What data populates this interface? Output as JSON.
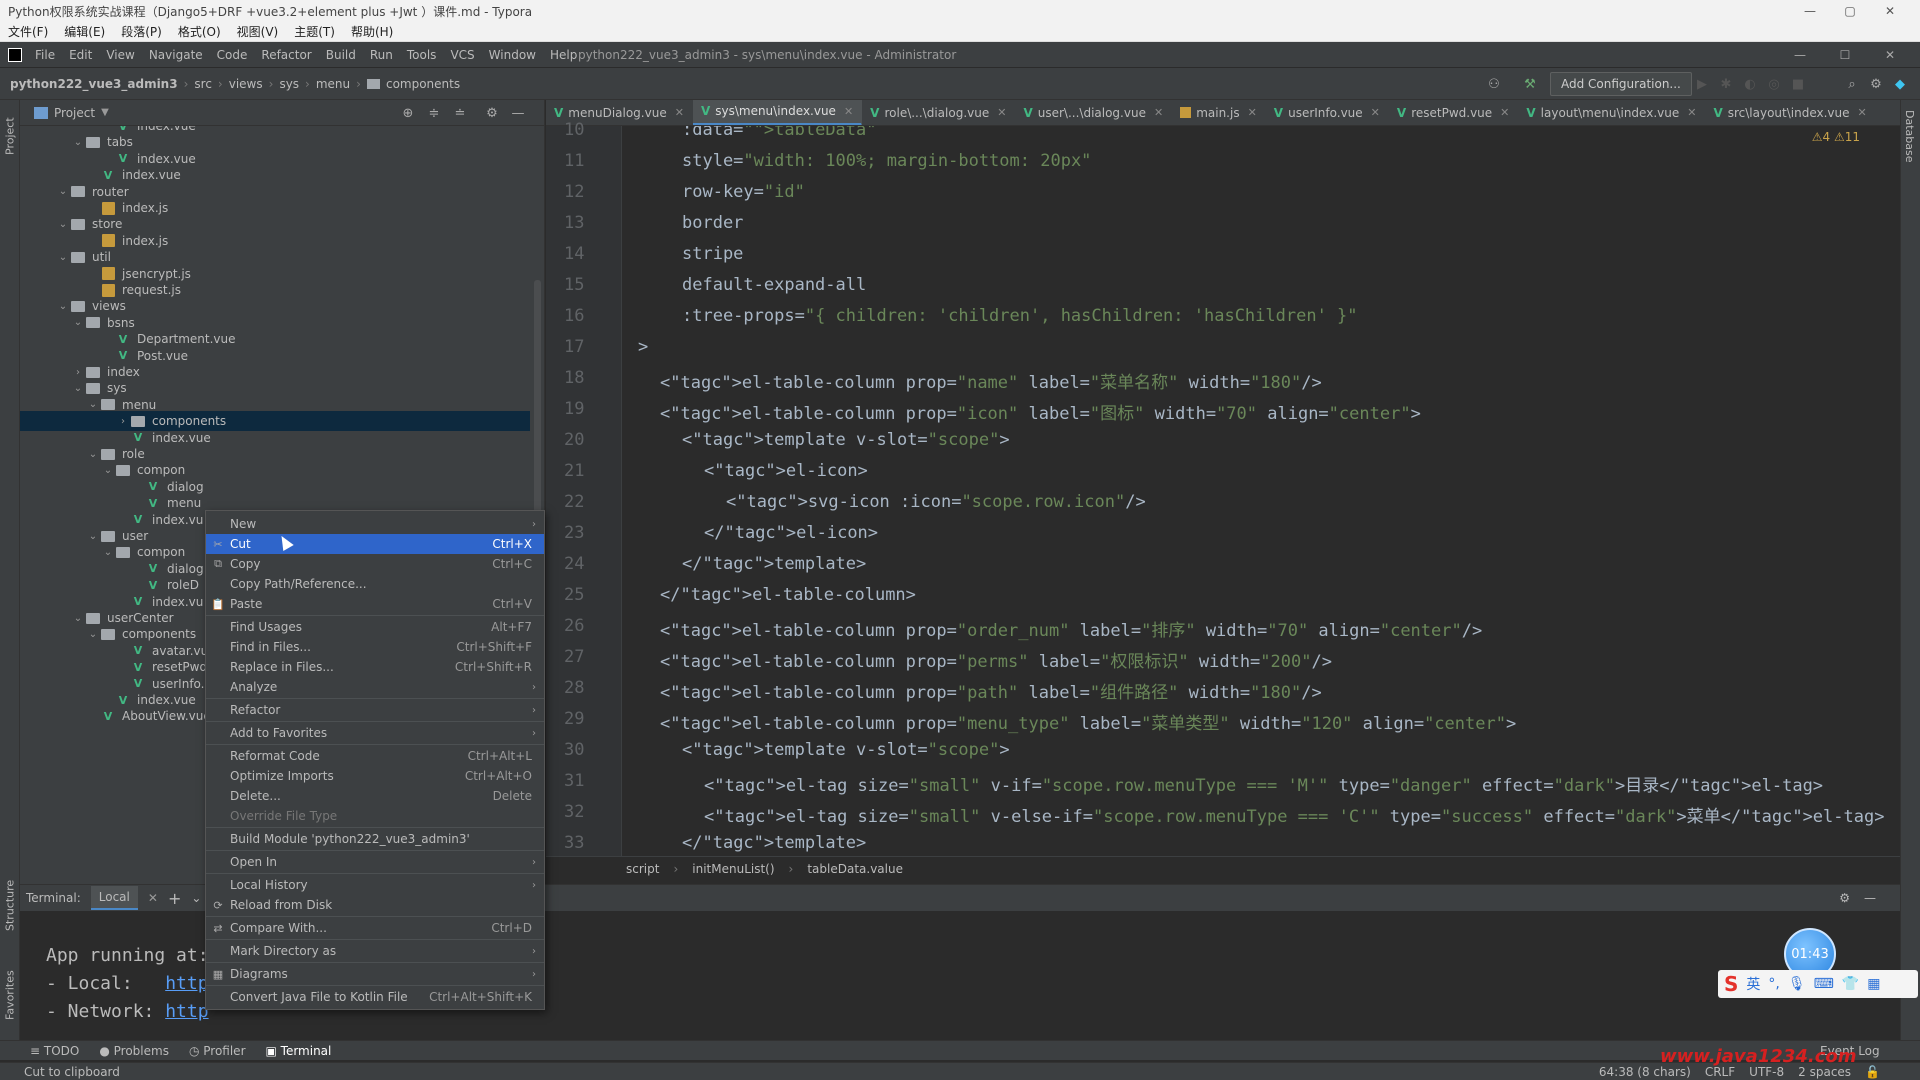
{
  "typora": {
    "title": "Python权限系统实战课程（Django5+DRF +vue3.2+element plus +Jwt ）课件.md - Typora",
    "menu": [
      "文件(F)",
      "编辑(E)",
      "段落(P)",
      "格式(O)",
      "视图(V)",
      "主题(T)",
      "帮助(H)"
    ]
  },
  "ide": {
    "menu": [
      "File",
      "Edit",
      "View",
      "Navigate",
      "Code",
      "Refactor",
      "Build",
      "Run",
      "Tools",
      "VCS",
      "Window",
      "Help"
    ],
    "window_title": "python222_vue3_admin3 - sys\\menu\\index.vue - Administrator",
    "breadcrumb": [
      "python222_vue3_admin3",
      "src",
      "views",
      "sys",
      "menu",
      "components"
    ],
    "add_configuration": "Add Configuration..."
  },
  "project": {
    "label": "Project",
    "strip_label": "Project",
    "tree": [
      {
        "label": "index.vue",
        "type": "vue",
        "depth": 5
      },
      {
        "label": "tabs",
        "type": "folder",
        "depth": 3,
        "open": true
      },
      {
        "label": "index.vue",
        "type": "vue",
        "depth": 5
      },
      {
        "label": "index.vue",
        "type": "vue",
        "depth": 4
      },
      {
        "label": "router",
        "type": "folder",
        "depth": 2,
        "open": true
      },
      {
        "label": "index.js",
        "type": "js",
        "depth": 4
      },
      {
        "label": "store",
        "type": "folder",
        "depth": 2,
        "open": true
      },
      {
        "label": "index.js",
        "type": "js",
        "depth": 4
      },
      {
        "label": "util",
        "type": "folder",
        "depth": 2,
        "open": true
      },
      {
        "label": "jsencrypt.js",
        "type": "js",
        "depth": 4
      },
      {
        "label": "request.js",
        "type": "js",
        "depth": 4
      },
      {
        "label": "views",
        "type": "folder",
        "depth": 2,
        "open": true
      },
      {
        "label": "bsns",
        "type": "folder",
        "depth": 3,
        "open": true
      },
      {
        "label": "Department.vue",
        "type": "vue",
        "depth": 5
      },
      {
        "label": "Post.vue",
        "type": "vue",
        "depth": 5
      },
      {
        "label": "index",
        "type": "folder",
        "depth": 3,
        "open": false
      },
      {
        "label": "sys",
        "type": "folder",
        "depth": 3,
        "open": true
      },
      {
        "label": "menu",
        "type": "folder",
        "depth": 4,
        "open": true
      },
      {
        "label": "components",
        "type": "folder",
        "depth": 6,
        "selected": true
      },
      {
        "label": "index.vue",
        "type": "vue",
        "depth": 6
      },
      {
        "label": "role",
        "type": "folder",
        "depth": 4,
        "open": true
      },
      {
        "label": "compon",
        "type": "folder",
        "depth": 5,
        "open": true
      },
      {
        "label": "dialog",
        "type": "vue",
        "depth": 7
      },
      {
        "label": "menu",
        "type": "vue",
        "depth": 7
      },
      {
        "label": "index.vu",
        "type": "vue",
        "depth": 6
      },
      {
        "label": "user",
        "type": "folder",
        "depth": 4,
        "open": true
      },
      {
        "label": "compon",
        "type": "folder",
        "depth": 5,
        "open": true
      },
      {
        "label": "dialog",
        "type": "vue",
        "depth": 7
      },
      {
        "label": "roleD",
        "type": "vue",
        "depth": 7
      },
      {
        "label": "index.vu",
        "type": "vue",
        "depth": 6
      },
      {
        "label": "userCenter",
        "type": "folder",
        "depth": 3,
        "open": true
      },
      {
        "label": "components",
        "type": "folder",
        "depth": 4,
        "open": true
      },
      {
        "label": "avatar.vu",
        "type": "vue",
        "depth": 6
      },
      {
        "label": "resetPwd",
        "type": "vue",
        "depth": 6
      },
      {
        "label": "userInfo.",
        "type": "vue",
        "depth": 6
      },
      {
        "label": "index.vue",
        "type": "vue",
        "depth": 5
      },
      {
        "label": "AboutView.vue",
        "type": "vue",
        "depth": 4
      }
    ]
  },
  "tabs": [
    {
      "label": "menuDialog.vue",
      "kind": "vue"
    },
    {
      "label": "sys\\menu\\index.vue",
      "kind": "vue",
      "active": true
    },
    {
      "label": "role\\...\\dialog.vue",
      "kind": "vue"
    },
    {
      "label": "user\\...\\dialog.vue",
      "kind": "vue"
    },
    {
      "label": "main.js",
      "kind": "js"
    },
    {
      "label": "userInfo.vue",
      "kind": "vue"
    },
    {
      "label": "resetPwd.vue",
      "kind": "vue"
    },
    {
      "label": "layout\\menu\\index.vue",
      "kind": "vue"
    },
    {
      "label": "src\\layout\\index.vue",
      "kind": "vue"
    }
  ],
  "editor": {
    "warnings": "⚠4 ⚠11",
    "lines": [
      {
        "n": "10",
        "indent": 4,
        "html": ":data=\"<i>tableData</i>\""
      },
      {
        "n": "11",
        "indent": 4,
        "html": "style=\"width: 100%; margin-bottom: 20px\""
      },
      {
        "n": "12",
        "indent": 4,
        "html": "row-key=\"id\""
      },
      {
        "n": "13",
        "indent": 4,
        "html": "border"
      },
      {
        "n": "14",
        "indent": 4,
        "html": "stripe"
      },
      {
        "n": "15",
        "indent": 4,
        "html": "default-expand-all"
      },
      {
        "n": "16",
        "indent": 4,
        "html": ":tree-props=\"{ children: 'children', hasChildren: 'hasChildren' }\""
      },
      {
        "n": "17",
        "indent": 2,
        "html": ">"
      },
      {
        "n": "18",
        "indent": 3,
        "html": "<el-table-column prop=\"name\" label=\"菜单名称\" width=\"180\"/>"
      },
      {
        "n": "19",
        "indent": 3,
        "html": "<el-table-column prop=\"icon\" label=\"图标\" width=\"70\" align=\"center\">"
      },
      {
        "n": "20",
        "indent": 4,
        "html": "<template v-slot=\"scope\">"
      },
      {
        "n": "21",
        "indent": 5,
        "html": "<el-icon>"
      },
      {
        "n": "22",
        "indent": 6,
        "html": "<svg-icon :icon=\"scope.row.icon\"/>"
      },
      {
        "n": "23",
        "indent": 5,
        "html": "</el-icon>"
      },
      {
        "n": "24",
        "indent": 4,
        "html": "</template>"
      },
      {
        "n": "25",
        "indent": 3,
        "html": "</el-table-column>"
      },
      {
        "n": "26",
        "indent": 3,
        "html": "<el-table-column prop=\"order_num\" label=\"排序\" width=\"70\" align=\"center\"/>"
      },
      {
        "n": "27",
        "indent": 3,
        "html": "<el-table-column prop=\"perms\" label=\"权限标识\" width=\"200\"/>"
      },
      {
        "n": "28",
        "indent": 3,
        "html": "<el-table-column prop=\"path\" label=\"组件路径\" width=\"180\"/>"
      },
      {
        "n": "29",
        "indent": 3,
        "html": "<el-table-column prop=\"menu_type\" label=\"菜单类型\" width=\"120\" align=\"center\">"
      },
      {
        "n": "30",
        "indent": 4,
        "html": "<template v-slot=\"scope\">"
      },
      {
        "n": "31",
        "indent": 5,
        "html": "<el-tag size=\"small\" v-if=\"scope.row.menuType === 'M'\" type=\"danger\" effect=\"dark\">目录</el-tag>"
      },
      {
        "n": "32",
        "indent": 5,
        "html": "<el-tag size=\"small\" v-else-if=\"scope.row.menuType === 'C'\" type=\"success\" effect=\"dark\">菜单</el-tag>"
      },
      {
        "n": "33",
        "indent": 4,
        "html": "</template>"
      }
    ]
  },
  "code_breadcrumb": [
    "script",
    "initMenuList()",
    "tableData.value"
  ],
  "context_menu": [
    {
      "label": "New",
      "sub": true
    },
    {
      "label": "Cut",
      "shortcut": "Ctrl+X",
      "icon": "✂",
      "highlight": true
    },
    {
      "label": "Copy",
      "shortcut": "Ctrl+C",
      "icon": "⧉"
    },
    {
      "label": "Copy Path/Reference..."
    },
    {
      "label": "Paste",
      "shortcut": "Ctrl+V",
      "icon": "📋"
    },
    {
      "sep": true
    },
    {
      "label": "Find Usages",
      "shortcut": "Alt+F7"
    },
    {
      "label": "Find in Files...",
      "shortcut": "Ctrl+Shift+F"
    },
    {
      "label": "Replace in Files...",
      "shortcut": "Ctrl+Shift+R"
    },
    {
      "label": "Analyze",
      "sub": true
    },
    {
      "sep": true
    },
    {
      "label": "Refactor",
      "sub": true
    },
    {
      "sep": true
    },
    {
      "label": "Add to Favorites",
      "sub": true
    },
    {
      "sep": true
    },
    {
      "label": "Reformat Code",
      "shortcut": "Ctrl+Alt+L"
    },
    {
      "label": "Optimize Imports",
      "shortcut": "Ctrl+Alt+O"
    },
    {
      "label": "Delete...",
      "shortcut": "Delete"
    },
    {
      "label": "Override File Type",
      "disabled": true
    },
    {
      "sep": true
    },
    {
      "label": "Build Module 'python222_vue3_admin3'"
    },
    {
      "sep": true
    },
    {
      "label": "Open In",
      "sub": true
    },
    {
      "sep": true
    },
    {
      "label": "Local History",
      "sub": true
    },
    {
      "label": "Reload from Disk",
      "icon": "⟳"
    },
    {
      "sep": true
    },
    {
      "label": "Compare With...",
      "shortcut": "Ctrl+D",
      "icon": "⇄"
    },
    {
      "sep": true
    },
    {
      "label": "Mark Directory as",
      "sub": true
    },
    {
      "sep": true
    },
    {
      "label": "Diagrams",
      "sub": true,
      "icon": "▦"
    },
    {
      "sep": true
    },
    {
      "label": "Convert Java File to Kotlin File",
      "shortcut": "Ctrl+Alt+Shift+K"
    }
  ],
  "terminal": {
    "label": "Terminal:",
    "tab": "Local",
    "lines": [
      "App running at:",
      "- Local:   ",
      "- Network: "
    ],
    "links": [
      "http",
      "http"
    ]
  },
  "bottom_tabs": [
    "TODO",
    "Problems",
    "Profiler",
    "Terminal"
  ],
  "left_tabs": [
    "Structure",
    "Favorites"
  ],
  "right_tabs": [
    "Database"
  ],
  "status": {
    "message": "Cut to clipboard",
    "position": "64:38 (8 chars)",
    "line_sep": "CRLF",
    "encoding": "UTF-8",
    "indent": "2 spaces",
    "event_log": "Event Log"
  },
  "overlay": {
    "clock": "01:43",
    "ime_mode": "英",
    "watermark": "www.java1234.com"
  }
}
